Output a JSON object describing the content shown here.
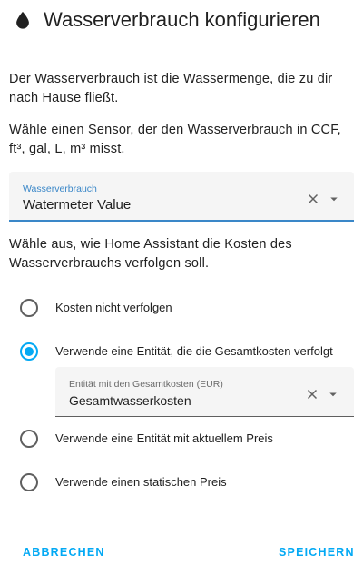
{
  "dialog": {
    "title": "Wasserverbrauch konfigurieren",
    "icon": "water-drop-icon",
    "intro": "Der Wasserverbrauch ist die Wassermenge, die zu dir nach Hause fließt.",
    "sensor_hint": "Wähle einen Sensor, der den Wasserverbrauch in CCF, ft³, gal, L, m³ misst."
  },
  "sensor_field": {
    "label": "Wasserverbrauch",
    "value": "Watermeter Value",
    "label_color": "#3a87c8"
  },
  "cost_section": {
    "prompt": "Wähle aus, wie Home Assistant die Kosten des Wasserverbrauchs verfolgen soll.",
    "options": [
      {
        "label": "Kosten nicht verfolgen",
        "selected": false
      },
      {
        "label": "Verwende eine Entität, die die Gesamtkosten verfolgt",
        "selected": true
      },
      {
        "label": "Verwende eine Entität mit aktuellem Preis",
        "selected": false
      },
      {
        "label": "Verwende einen statischen Preis",
        "selected": false
      }
    ]
  },
  "cost_entity_field": {
    "label": "Entität mit den Gesamtkosten (EUR)",
    "value": "Gesamtwasserkosten",
    "label_color": "#6b6b6b"
  },
  "actions": {
    "cancel_label": "ABBRECHEN",
    "save_label": "SPEICHERN"
  },
  "colors": {
    "accent": "#03a9f4",
    "field_bg": "#f5f5f5"
  }
}
